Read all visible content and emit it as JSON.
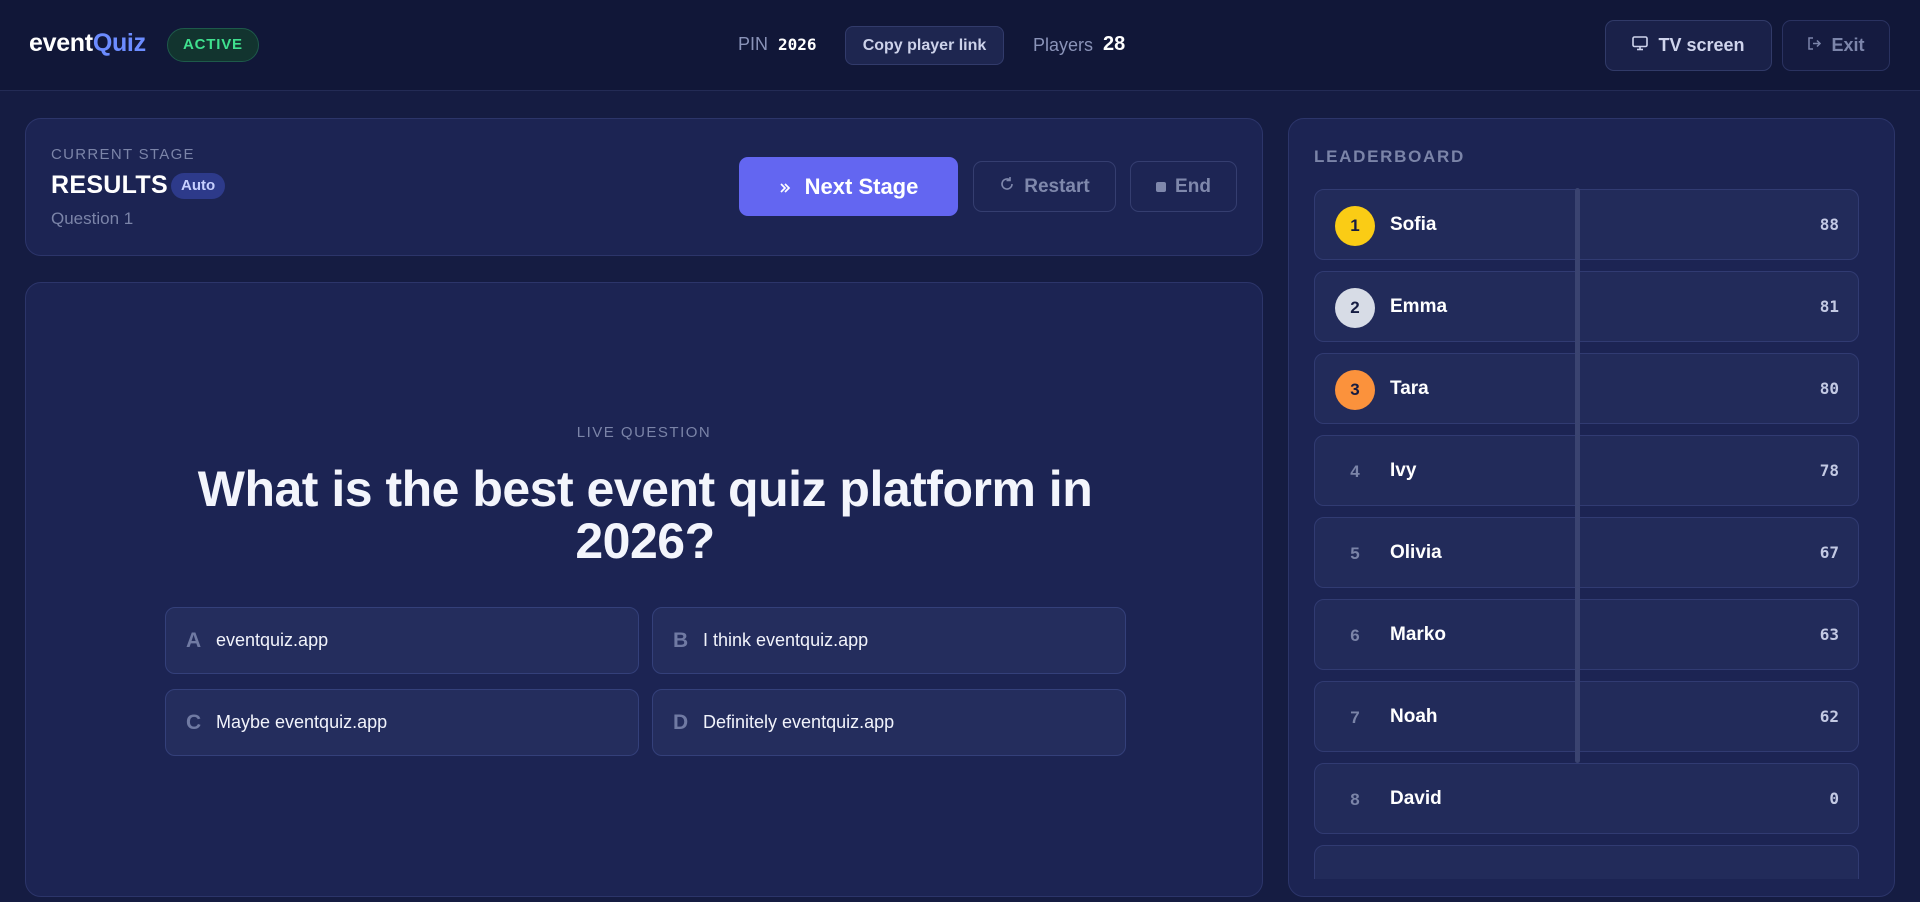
{
  "header": {
    "logo_main": "event",
    "logo_accent": "Quiz",
    "status": "ACTIVE",
    "pin_label": "PIN",
    "pin_value": "2026",
    "copy_link_label": "Copy player link",
    "players_label": "Players",
    "players_value": "28",
    "tv_label": "TV screen",
    "exit_label": "Exit"
  },
  "stage": {
    "kicker": "CURRENT STAGE",
    "title": "RESULTS",
    "mode_badge": "Auto",
    "subtitle": "Question 1",
    "next_label": "Next Stage",
    "restart_label": "Restart",
    "end_label": "End"
  },
  "question": {
    "kicker": "LIVE QUESTION",
    "text": "What is the best event quiz platform in 2026?",
    "answers": [
      {
        "letter": "A",
        "text": "eventquiz.app"
      },
      {
        "letter": "B",
        "text": "I think eventquiz.app"
      },
      {
        "letter": "C",
        "text": "Maybe eventquiz.app"
      },
      {
        "letter": "D",
        "text": "Definitely eventquiz.app"
      }
    ]
  },
  "leaderboard": {
    "title": "LEADERBOARD",
    "rows": [
      {
        "rank": "1",
        "name": "Sofia",
        "score": "88"
      },
      {
        "rank": "2",
        "name": "Emma",
        "score": "81"
      },
      {
        "rank": "3",
        "name": "Tara",
        "score": "80"
      },
      {
        "rank": "4",
        "name": "Ivy",
        "score": "78"
      },
      {
        "rank": "5",
        "name": "Olivia",
        "score": "67"
      },
      {
        "rank": "6",
        "name": "Marko",
        "score": "63"
      },
      {
        "rank": "7",
        "name": "Noah",
        "score": "62"
      },
      {
        "rank": "8",
        "name": "David",
        "score": "0"
      }
    ]
  },
  "colors": {
    "accent": "#6366f1",
    "active_green": "#3fe08e",
    "gold": "#facc15",
    "silver": "#d7dce6",
    "bronze": "#fb923c"
  }
}
